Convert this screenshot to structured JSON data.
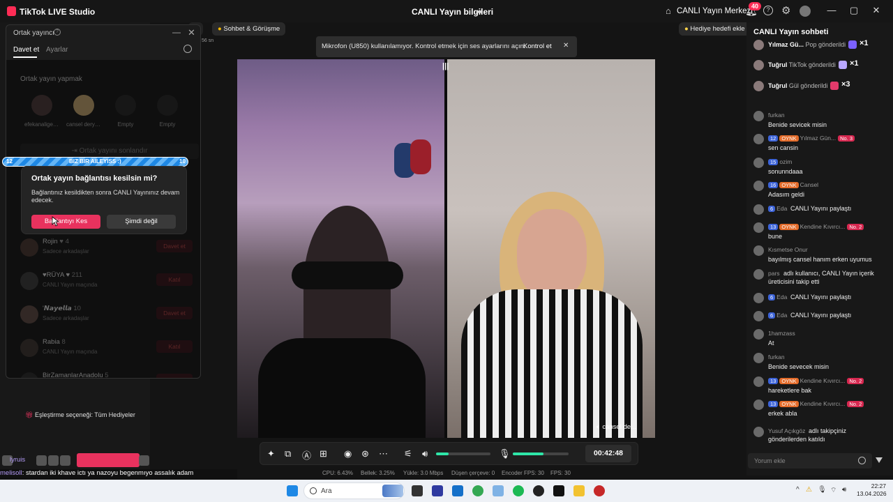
{
  "titlebar": {
    "app_name": "TikTok LIVE Studio",
    "center_title": "CANLI Yayın bilgileri",
    "center_link": "CANLI Yayın Merkezi",
    "notif_count": "40",
    "help": "?",
    "minimize": "—",
    "maximize": "▢",
    "close": "✕"
  },
  "chips": {
    "cut": "a",
    "chat_gift": "Sohbet & Görüşme",
    "gift_goal": "Hediye hedefi ekle",
    "time_small": "56 sn"
  },
  "notice": {
    "text": "Mikrofon (U850) kullanılamıyor. Kontrol etmek için ses ayarlarını açın.",
    "link": "Kontrol et",
    "close": "✕"
  },
  "popup": {
    "title": "Ortak yayıncı",
    "help": "?",
    "close": "✕",
    "minimize": "—",
    "tabs": [
      "Davet et",
      "Ayarlar"
    ],
    "section_title": "Ortak yayın yapmak",
    "slots": [
      {
        "label": "efekanaligec..."
      },
      {
        "label": "cansel derya..."
      },
      {
        "label": "Empty"
      },
      {
        "label": "Empty"
      }
    ],
    "end_cohost": "Ortak yayını sonlandır",
    "users": [
      {
        "name": "Rojin",
        "badge": "♥ 4",
        "sub": "Sadece arkadaşlar",
        "btn": "Davet et"
      },
      {
        "name": "♥RÜYA ♥",
        "badge": "211",
        "sub": "CANLI Yayın maçında",
        "btn": "Katıl"
      },
      {
        "name": "'𝙉𝙖𝙮𝙚𝙡𝙡𝙖",
        "badge": "10",
        "sub": "Sadece arkadaşlar",
        "btn": "Davet et"
      },
      {
        "name": "Rabia",
        "badge": "8",
        "sub": "CANLI Yayın maçında",
        "btn": "Katıl"
      },
      {
        "name": "BirZamanlarAnadolu",
        "badge": "5",
        "sub": "",
        "btn": "Davet et"
      }
    ]
  },
  "banner": {
    "left": "12",
    "text": "BIZ BIR AILEYISS :)",
    "right": "10",
    "progress": 1.0
  },
  "dialog": {
    "question": "Ortak yayın bağlantısı kesilsin mi?",
    "body": "Bağlantınız kesildikten sonra CANLI Yayınınız devam edecek.",
    "disconnect": "Bağlantıyı Kes",
    "later": "Şimdi değil"
  },
  "left_panel": {
    "match_option": "Eşleştirme seçeneği: Tüm Hediyeler"
  },
  "stage": {
    "right_label": "cansel de...",
    "bars": "|||"
  },
  "controls": {
    "timer": "00:42:48",
    "speaker_level": 0.23,
    "mic_level": 0.55
  },
  "stats": {
    "cpu": "CPU: 6.43%",
    "mem": "Bellek: 3.25%",
    "upload": "Yükle: 3.0 Mbps",
    "dropped": "Düşen çerçeve: 0",
    "encoder_fps": "Encoder FPS: 30",
    "fps": "FPS: 30"
  },
  "chat": {
    "title": "CANLI Yayın sohbeti",
    "gifts": [
      {
        "name": "Yılmaz Gü...",
        "action": "Pop gönderildi",
        "count": "×1",
        "color": "#7b61ff"
      },
      {
        "name": "Tuğrul",
        "action": "TikTok gönderildi",
        "count": "×1",
        "color": "#b9a7ff"
      },
      {
        "name": "Tuğrul",
        "action": "Gül gönderildi",
        "count": "×3",
        "color": "#e33a6b"
      }
    ],
    "messages": [
      {
        "user": "furkan",
        "lv": "",
        "fan": "",
        "rank": "",
        "text": "Benide sevicek misin"
      },
      {
        "user": "Yılmaz Gün...",
        "lv": "12",
        "fan": "OYNK",
        "rank": "No. 3",
        "text": "sen cansin"
      },
      {
        "user": "ozim",
        "lv": "15",
        "fan": "",
        "rank": "",
        "text": "sonunndaaa"
      },
      {
        "user": "Cansel",
        "lv": "16",
        "fan": "OYNK",
        "rank": "",
        "text": "Adasım geldi"
      },
      {
        "user": "Eda",
        "lv": "6",
        "fan": "",
        "rank": "",
        "text": "CANLI Yayını paylaştı",
        "share": true
      },
      {
        "user": "Kendine Kıvırcı...",
        "lv": "13",
        "fan": "OYNK",
        "rank": "No. 2",
        "text": "bune"
      },
      {
        "user": "Kısmetse Onur",
        "lv": "",
        "fan": "",
        "rank": "",
        "text": "bayılmış cansel hanım erken uyumus"
      },
      {
        "user": "pars",
        "lv": "",
        "fan": "",
        "rank": "",
        "text": "adlı kullanıcı, CANLI Yayın içerik",
        "text2": "üreticisini takip etti",
        "share": true
      },
      {
        "user": "Eda",
        "lv": "6",
        "fan": "",
        "rank": "",
        "text": "CANLI Yayını paylaştı",
        "share": true
      },
      {
        "user": "Eda",
        "lv": "6",
        "fan": "",
        "rank": "",
        "text": "CANLI Yayını paylaştı",
        "share": true
      },
      {
        "user": "1hamzass",
        "lv": "",
        "fan": "",
        "rank": "",
        "text": "At"
      },
      {
        "user": "furkan",
        "lv": "",
        "fan": "",
        "rank": "",
        "text": "Benide sevecek misin"
      },
      {
        "user": "Kendine Kıvırcı...",
        "lv": "13",
        "fan": "OYNK",
        "rank": "No. 2",
        "text": "hareketlere bak"
      },
      {
        "user": "Kendine Kıvırcı...",
        "lv": "13",
        "fan": "OYNK",
        "rank": "No. 2",
        "text": "erkek abla"
      },
      {
        "user": "Yusuf Açıkgöz",
        "lv": "",
        "fan": "",
        "rank": "",
        "text": "adlı takipçiniz",
        "text2": "gönderilerden katıldı",
        "share": true
      }
    ],
    "input_placeholder": "Yorum ekle"
  },
  "ticker": {
    "user_a": "lyruis",
    "user_b": "melisoll",
    "text": ": stardan iki khave ictı ya nazoyu begenmıyo assalık adam"
  },
  "taskbar": {
    "search": "Ara",
    "time": "22:27",
    "date": "13.04.2026"
  }
}
